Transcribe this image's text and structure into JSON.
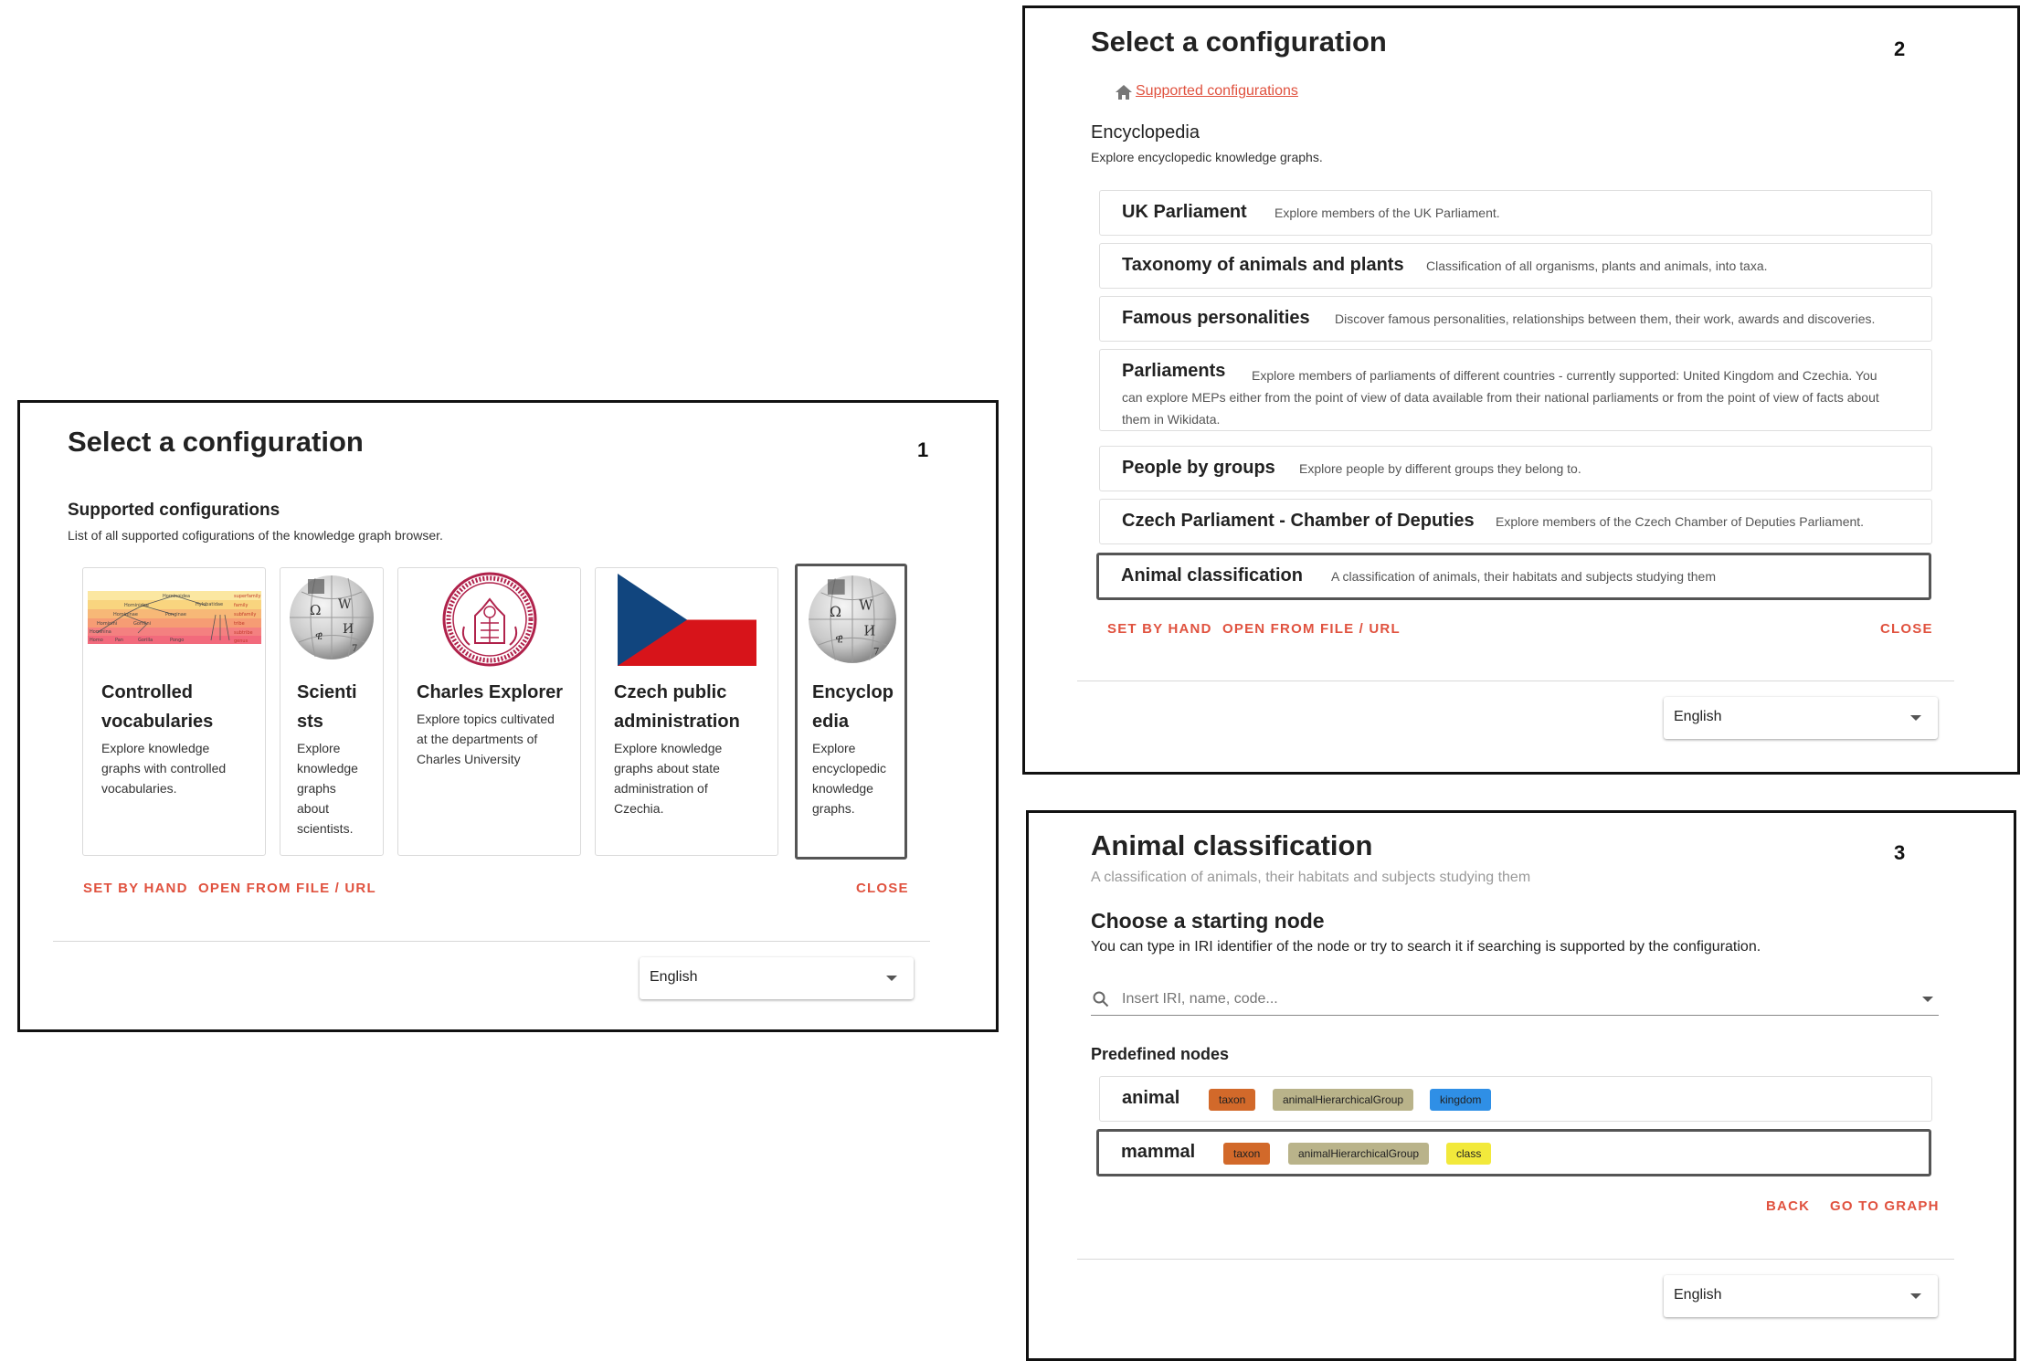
{
  "panel1": {
    "number": "1",
    "title": "Select a configuration",
    "section_title": "Supported configurations",
    "section_desc": "List of all supported cofigurations of the knowledge graph browser.",
    "cards": [
      {
        "title_line1": "Controlled",
        "title_line2": "vocabularies",
        "desc_lines": [
          "Explore knowledge",
          "graphs with controlled",
          "vocabularies."
        ],
        "image": "hierarchy-diagram"
      },
      {
        "title_line1": "Scienti",
        "title_line2": "sts",
        "desc_lines": [
          "Explore",
          "knowledge",
          "graphs",
          "about",
          "scientists."
        ],
        "image": "wikipedia-globe"
      },
      {
        "title_line1": "Charles Explorer",
        "title_line2": "",
        "desc_lines": [
          "Explore topics cultivated",
          "at the departments of",
          "Charles University"
        ],
        "image": "charles-university-seal"
      },
      {
        "title_line1": "Czech public",
        "title_line2": "administration",
        "desc_lines": [
          "Explore knowledge",
          "graphs about state",
          "administration of",
          "Czechia."
        ],
        "image": "czech-flag"
      },
      {
        "title_line1": "Encyclop",
        "title_line2": "edia",
        "desc_lines": [
          "Explore",
          "encyclopedic",
          "knowledge",
          "graphs."
        ],
        "image": "wikipedia-globe",
        "selected": true
      }
    ],
    "buttons": {
      "set_by_hand": "SET BY HAND",
      "open_file": "OPEN FROM FILE / URL",
      "close": "CLOSE"
    },
    "language": "English"
  },
  "panel2": {
    "number": "2",
    "title": "Select a configuration",
    "breadcrumb": "Supported configurations",
    "section_title": "Encyclopedia",
    "section_desc": "Explore encyclopedic knowledge graphs.",
    "items": [
      {
        "title": "UK Parliament",
        "desc": "Explore members of the UK Parliament."
      },
      {
        "title": "Taxonomy of animals and plants",
        "desc": "Classification of all organisms, plants and animals, into taxa."
      },
      {
        "title": "Famous personalities",
        "desc": "Discover famous personalities, relationships between them, their work, awards and discoveries."
      },
      {
        "title": "Parliaments",
        "desc_lines": [
          "Explore members of parliaments of different countries - currently supported: United Kingdom and Czechia. You",
          "can explore MEPs either from the point of view of data available from their national parliaments or from the point of view of facts about",
          "them in Wikidata."
        ]
      },
      {
        "title": "People by groups",
        "desc": "Explore people by different groups they belong to."
      },
      {
        "title": "Czech Parliament - Chamber of Deputies",
        "desc": "Explore members of the Czech Chamber of Deputies Parliament."
      },
      {
        "title": "Animal classification",
        "desc": "A classification of animals, their habitats and subjects studying them",
        "selected": true
      }
    ],
    "buttons": {
      "set_by_hand": "SET BY HAND",
      "open_file": "OPEN FROM FILE / URL",
      "close": "CLOSE"
    },
    "language": "English"
  },
  "panel3": {
    "number": "3",
    "title": "Animal classification",
    "subtitle": "A classification of animals, their habitats and subjects studying them",
    "section_title": "Choose a starting node",
    "section_desc": "You can type in IRI identifier of the node or try to search it if searching is supported by the configuration.",
    "search": {
      "placeholder": "Insert IRI, name, code..."
    },
    "predefined_title": "Predefined nodes",
    "nodes": [
      {
        "name": "animal",
        "chips": [
          {
            "label": "taxon",
            "color": "#d2692a"
          },
          {
            "label": "animalHierarchicalGroup",
            "color": "#b9b38a"
          },
          {
            "label": "kingdom",
            "color": "#2f8fe6"
          }
        ]
      },
      {
        "name": "mammal",
        "chips": [
          {
            "label": "taxon",
            "color": "#d2692a"
          },
          {
            "label": "animalHierarchicalGroup",
            "color": "#b9b38a"
          },
          {
            "label": "class",
            "color": "#f2e93b"
          }
        ],
        "selected": true
      }
    ],
    "buttons": {
      "back": "BACK",
      "go_to_graph": "GO TO GRAPH"
    },
    "language": "English"
  },
  "colors": {
    "accent": "#e0523f",
    "selected_border": "#555555"
  }
}
